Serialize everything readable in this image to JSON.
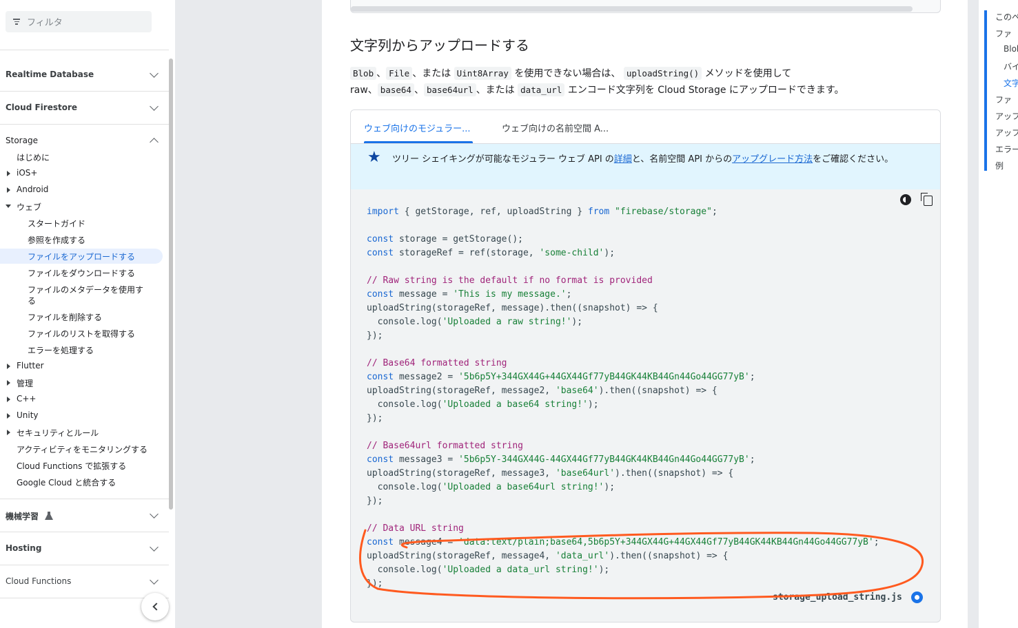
{
  "sidebar": {
    "filter_placeholder": "フィルタ",
    "sections": {
      "realtime_database": "Realtime Database",
      "cloud_firestore": "Cloud Firestore",
      "storage": "Storage",
      "ml": "機械学習",
      "hosting": "Hosting",
      "cloud_functions": "Cloud Functions"
    },
    "storage_items": {
      "intro": "はじめに",
      "ios": "iOS+",
      "android": "Android",
      "web": "ウェブ",
      "web_start": "スタートガイド",
      "web_ref": "参照を作成する",
      "web_upload": "ファイルをアップロードする",
      "web_download": "ファイルをダウンロードする",
      "web_metadata_1": "ファイルのメタデータを使用す",
      "web_metadata_2": "る",
      "web_delete": "ファイルを削除する",
      "web_list": "ファイルのリストを取得する",
      "web_errors": "エラーを処理する",
      "flutter": "Flutter",
      "admin": "管理",
      "cpp": "C++",
      "unity": "Unity",
      "security": "セキュリティとルール",
      "monitor": "アクティビティをモニタリングする",
      "functions": "Cloud Functions で拡張する",
      "gcloud": "Google Cloud と統合する"
    }
  },
  "main": {
    "heading": "文字列からアップロードする",
    "para_line1": {
      "blob": "Blob",
      "sep1": "、",
      "file": "File",
      "sep2": "、または",
      "uint8": "Uint8Array",
      "mid": "を使用できない場合は、",
      "upload_fn": "uploadString()",
      "end": "メソッドを使用して"
    },
    "para_line2": {
      "raw": "raw、",
      "b64": "base64",
      "sep1": "、",
      "b64url": "base64url",
      "sep2": "、または",
      "dataurl": "data_url",
      "end": "エンコード文字列を Cloud Storage にアップロードできます。"
    },
    "tabs": [
      "ウェブ向けのモジュラー...",
      "ウェブ向けの名前空間 A..."
    ],
    "note": {
      "t1": "ツリー シェイキングが可能なモジュラー ウェブ API の",
      "link1": "詳細",
      "t2": "と、名前空間 API からの",
      "link2": "アップグレード方法",
      "t3": "をご確認ください。"
    },
    "code": {
      "l01a": "import",
      "l01b": " { getStorage, ref, uploadString } ",
      "l01c": "from",
      "l01d": " ",
      "l01e": "\"firebase/storage\"",
      "l01f": ";",
      "l03a": "const",
      "l03b": " storage = getStorage();",
      "l04a": "const",
      "l04b": " storageRef = ref(storage, ",
      "l04c": "'some-child'",
      "l04d": ");",
      "l06": "// Raw string is the default if no format is provided",
      "l07a": "const",
      "l07b": " message = ",
      "l07c": "'This is my message.'",
      "l07d": ";",
      "l08": "uploadString(storageRef, message).then((snapshot) => {",
      "l09a": "  console.log(",
      "l09b": "'Uploaded a raw string!'",
      "l09c": ");",
      "l10": "});",
      "l12": "// Base64 formatted string",
      "l13a": "const",
      "l13b": " message2 = ",
      "l13c": "'5b6p5Y+344GX44G+44GX44Gf77yB44GK44KB44Gn44Go44GG77yB'",
      "l13d": ";",
      "l14a": "uploadString(storageRef, message2, ",
      "l14b": "'base64'",
      "l14c": ").then((snapshot) => {",
      "l15a": "  console.log(",
      "l15b": "'Uploaded a base64 string!'",
      "l15c": ");",
      "l16": "});",
      "l18": "// Base64url formatted string",
      "l19a": "const",
      "l19b": " message3 = ",
      "l19c": "'5b6p5Y-344GX44G-44GX44Gf77yB44GK44KB44Gn44Go44GG77yB'",
      "l19d": ";",
      "l20a": "uploadString(storageRef, message3, ",
      "l20b": "'base64url'",
      "l20c": ").then((snapshot) => {",
      "l21a": "  console.log(",
      "l21b": "'Uploaded a base64url string!'",
      "l21c": ");",
      "l22": "});",
      "l24": "// Data URL string",
      "l25a": "const",
      "l25b": " message4 = ",
      "l25c": "'data:text/plain;base64,5b6p5Y+344GX44G+44GX44Gf77yB44GK44KB44Gn44Go44GG77yB'",
      "l25d": ";",
      "l26a": "uploadString(storageRef, message4, ",
      "l26b": "'data_url'",
      "l26c": ").then((snapshot) => {",
      "l27a": "  console.log(",
      "l27b": "'Uploaded a data_url string!'",
      "l27c": ");",
      "l28": "});"
    },
    "source_file": "storage_upload_string.js"
  },
  "toc": {
    "items": [
      "このペ",
      "ファ",
      "Blob",
      "バイ",
      "文字",
      "ファ",
      "アッフ",
      "アッフ",
      "エラー",
      "例"
    ]
  },
  "colors": {
    "accent": "#1a73e8",
    "annotation": "#ff5a1f",
    "comment": "#a0247a",
    "string": "#188038",
    "keyword": "#1967d2"
  },
  "icons": [
    "filter-icon",
    "chevron-down-icon",
    "chevron-up-icon",
    "flask-icon",
    "star-icon",
    "theme-toggle-icon",
    "copy-icon",
    "github-icon",
    "collapse-sidebar-icon"
  ]
}
